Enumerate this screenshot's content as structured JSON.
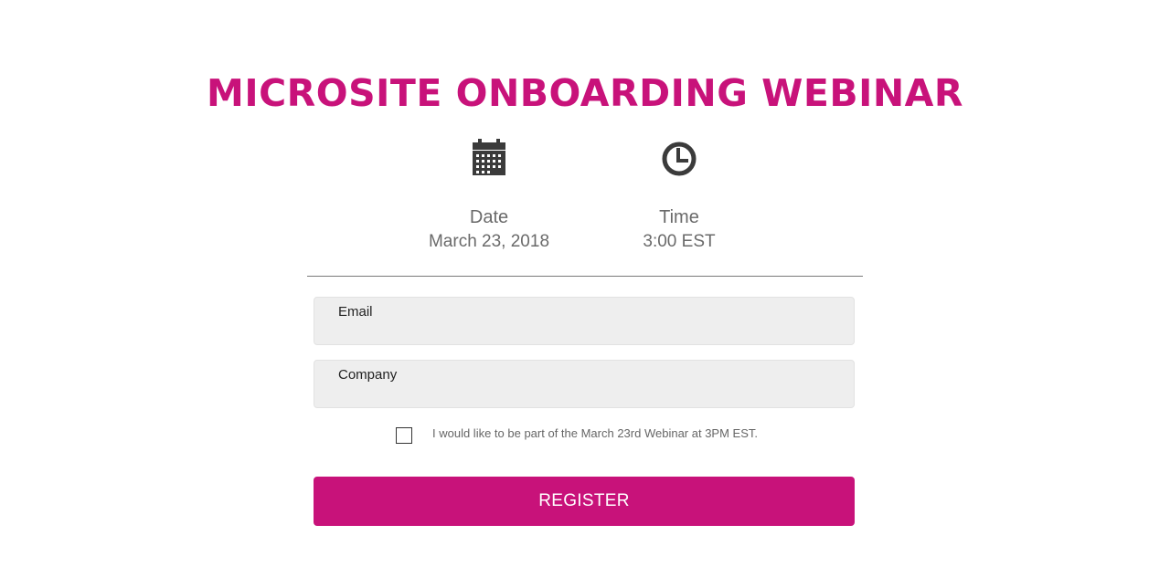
{
  "header": {
    "title": "MICROSITE ONBOARDING WEBINAR"
  },
  "details": {
    "date": {
      "icon": "calendar-icon",
      "label": "Date",
      "value": "March 23, 2018"
    },
    "time": {
      "icon": "clock-icon",
      "label": "Time",
      "value": "3:00 EST"
    }
  },
  "form": {
    "email": {
      "label": "Email",
      "value": ""
    },
    "company": {
      "label": "Company",
      "value": ""
    },
    "consent": {
      "checked": false,
      "text": "I would like to be part of the March 23rd Webinar at 3PM EST."
    },
    "submit_label": "REGISTER"
  },
  "colors": {
    "accent": "#c8127a",
    "icon": "#3b3b3b",
    "field_background": "#eeeeee",
    "muted_text": "#6a6a6a"
  }
}
